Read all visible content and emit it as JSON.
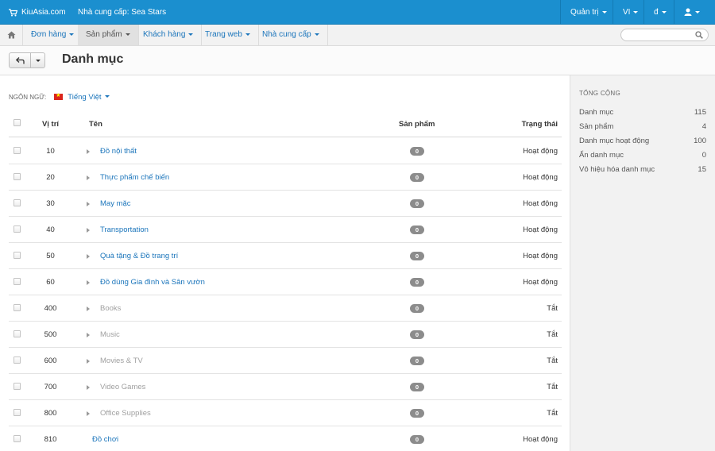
{
  "topbar": {
    "brand": "KiuAsia.com",
    "vendor": "Nhà cung cấp: Sea Stars",
    "menus": [
      "Quản trị",
      "VI",
      "đ"
    ]
  },
  "navbar": {
    "items": [
      "Đơn hàng",
      "Sản phẩm",
      "Khách hàng",
      "Trang web",
      "Nhà cung cấp"
    ],
    "active_index": 1,
    "search_placeholder": ""
  },
  "page": {
    "title": "Danh mục"
  },
  "language": {
    "label": "NGÔN NGỮ:",
    "value": "Tiếng Việt"
  },
  "table": {
    "headers": {
      "position": "Vị trí",
      "name": "Tên",
      "products": "Sản phẩm",
      "status": "Trạng thái"
    },
    "rows": [
      {
        "position": "10",
        "name": "Đồ nội thất",
        "products": "0",
        "status": "Hoạt động",
        "active": true,
        "has_children": true
      },
      {
        "position": "20",
        "name": "Thực phẩm chế biến",
        "products": "0",
        "status": "Hoạt động",
        "active": true,
        "has_children": true
      },
      {
        "position": "30",
        "name": "May mặc",
        "products": "0",
        "status": "Hoạt động",
        "active": true,
        "has_children": true
      },
      {
        "position": "40",
        "name": "Transportation",
        "products": "0",
        "status": "Hoạt động",
        "active": true,
        "has_children": true
      },
      {
        "position": "50",
        "name": "Quà tặng & Đồ trang trí",
        "products": "0",
        "status": "Hoạt động",
        "active": true,
        "has_children": true
      },
      {
        "position": "60",
        "name": "Đồ dùng Gia đình và Sân vườn",
        "products": "0",
        "status": "Hoạt động",
        "active": true,
        "has_children": true
      },
      {
        "position": "400",
        "name": "Books",
        "products": "0",
        "status": "Tắt",
        "active": false,
        "has_children": true
      },
      {
        "position": "500",
        "name": "Music",
        "products": "0",
        "status": "Tắt",
        "active": false,
        "has_children": true
      },
      {
        "position": "600",
        "name": "Movies & TV",
        "products": "0",
        "status": "Tắt",
        "active": false,
        "has_children": true
      },
      {
        "position": "700",
        "name": "Video Games",
        "products": "0",
        "status": "Tắt",
        "active": false,
        "has_children": true
      },
      {
        "position": "800",
        "name": "Office Supplies",
        "products": "0",
        "status": "Tắt",
        "active": false,
        "has_children": true
      },
      {
        "position": "810",
        "name": "Đồ chơi",
        "products": "0",
        "status": "Hoạt động",
        "active": true,
        "has_children": false
      }
    ]
  },
  "sidebar": {
    "title": "TỔNG CỘNG",
    "stats": [
      {
        "label": "Danh mục",
        "value": "115"
      },
      {
        "label": "Sản phẩm",
        "value": "4"
      },
      {
        "label": "Danh mục hoạt động",
        "value": "100"
      },
      {
        "label": "Ẩn danh mục",
        "value": "0"
      },
      {
        "label": "Vô hiệu hóa danh mục",
        "value": "15"
      }
    ]
  },
  "colors": {
    "topbar": "#1b8fcf",
    "link": "#1b75bb",
    "badge": "#8c8c8c",
    "disabled_text": "#a0a0a0"
  },
  "icons": {
    "brand": "cart-icon",
    "home": "home-icon",
    "search": "search-icon",
    "back": "back-arrow-icon",
    "user": "user-icon"
  }
}
